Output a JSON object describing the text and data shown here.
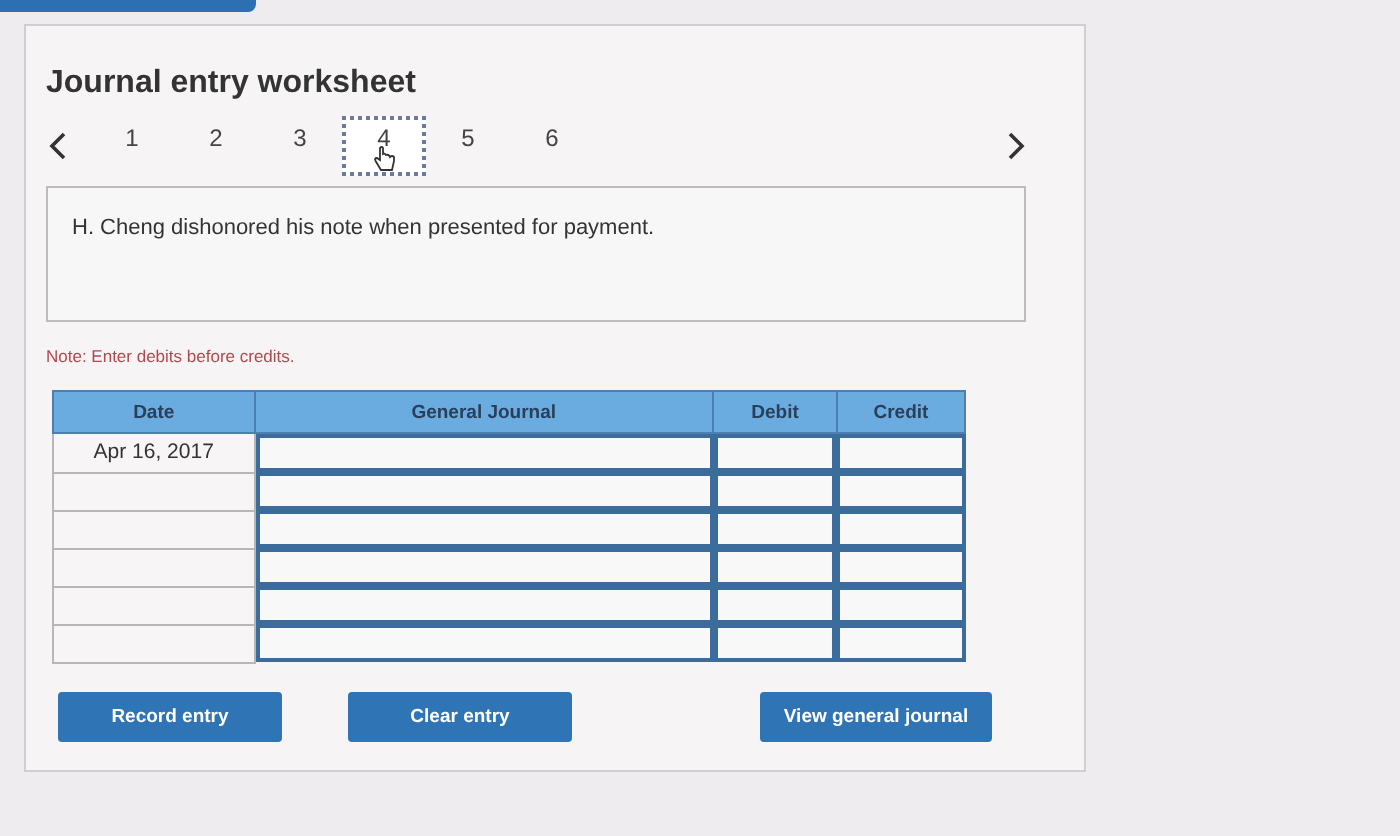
{
  "title": "Journal entry worksheet",
  "pager": {
    "pages": [
      {
        "label": "1",
        "selected": false
      },
      {
        "label": "2",
        "selected": false
      },
      {
        "label": "3",
        "selected": false
      },
      {
        "label": "4",
        "selected": true
      },
      {
        "label": "5",
        "selected": false
      },
      {
        "label": "6",
        "selected": false
      }
    ]
  },
  "prompt": "H. Cheng dishonored his note when presented for payment.",
  "note": "Note: Enter debits before credits.",
  "table": {
    "columns": [
      "Date",
      "General Journal",
      "Debit",
      "Credit"
    ],
    "rows": [
      {
        "date": "Apr 16, 2017"
      },
      {},
      {},
      {},
      {},
      {}
    ]
  },
  "buttons": [
    "Record entry",
    "Clear entry",
    "View general journal"
  ]
}
